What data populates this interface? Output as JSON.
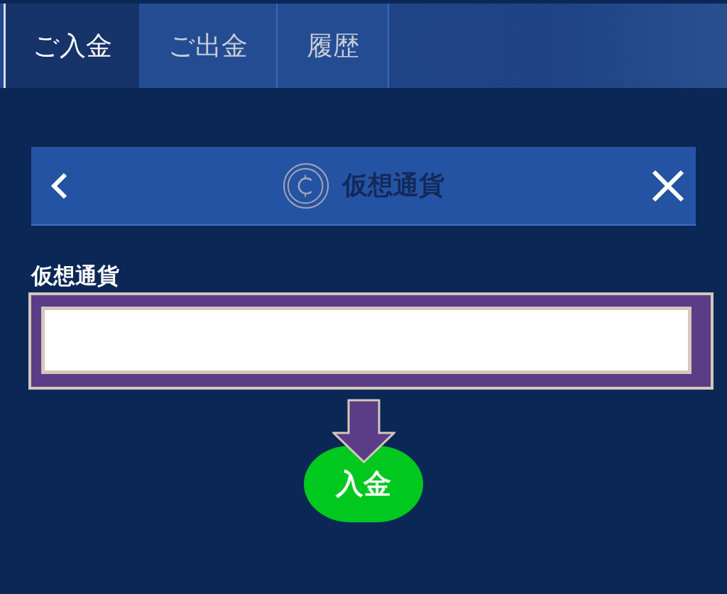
{
  "tabs": [
    {
      "label": "ご入金",
      "selected": true
    },
    {
      "label": "ご出金",
      "selected": false
    },
    {
      "label": "履歴",
      "selected": false
    }
  ],
  "panel": {
    "title": "仮想通貨"
  },
  "form": {
    "label": "仮想通貨",
    "field": {
      "highlighted": true
    }
  },
  "submit_button": {
    "label": "入金",
    "arrow_pointing": true
  }
}
